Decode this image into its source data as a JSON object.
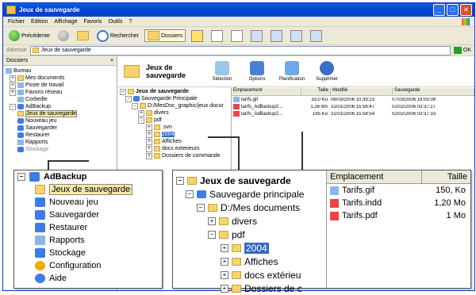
{
  "window": {
    "title": "Jeux de sauvegarde",
    "controls": [
      "_",
      "□",
      "×"
    ]
  },
  "menu": [
    "Fichier",
    "Edition",
    "Affichage",
    "Favoris",
    "Outils",
    "?"
  ],
  "toolbar": {
    "back": "Précédente",
    "search": "Rechercher",
    "folders": "Dossiers"
  },
  "address": {
    "label": "Adresse",
    "value": "Jeux de sauvegarde",
    "go": "OK"
  },
  "sidebar": {
    "title": "Dossiers",
    "close": "×",
    "items": [
      "Bureau",
      "Mes documents",
      "Poste de travail",
      "Favoris réseau",
      "Corbeille",
      "AdBackup",
      "Jeux de sauvegarde",
      "Nouveau jeu",
      "Sauvegarder",
      "Restaurer",
      "Rapports",
      "Stockage"
    ]
  },
  "app": {
    "title": "Jeux de sauvegarde",
    "tools": [
      "Sélection",
      "Options",
      "Planification",
      "Supprimer"
    ]
  },
  "small_tree": [
    "Jeux de sauvegarde",
    "Sauvegarde Principale",
    "D:/MesDoc_graphic/jeux docur",
    "divers",
    "pdf",
    ".svn",
    "2004",
    "Affiches",
    "docs exterieurs",
    "Dossiers de commande"
  ],
  "small_list": {
    "headers": [
      "Emplacement",
      "Taille",
      "Modifié",
      "Sauvegarde"
    ],
    "rows": [
      [
        "tarifs.gif",
        "33,0 Ko",
        "06/03/2006 10:39:23",
        "07/03/2006 19:05:08"
      ],
      [
        "tarifs_AdBackup2...",
        "1,26 Mo",
        "31/01/2006 15:58:47",
        "02/02/2006 03:37:27"
      ],
      [
        "tarifs_AdBackup2...",
        "195 Ko",
        "31/01/2006 15:58:54",
        "02/02/2006 03:37:33"
      ]
    ]
  },
  "zoom_left": {
    "root": "AdBackup",
    "items": [
      "Jeux de sauvegarde",
      "Nouveau jeu",
      "Sauvegarder",
      "Restaurer",
      "Rapports",
      "Stockage",
      "Configuration",
      "Aide"
    ]
  },
  "zoom_right": {
    "tree": [
      "Jeux de sauvegarde",
      "Sauvegarde principale",
      "D:/Mes documents",
      "divers",
      "pdf",
      "2004",
      "Affiches",
      "docs extérieu",
      "Dossiers de c"
    ],
    "headers": [
      "Emplacement",
      "Taille"
    ],
    "rows": [
      [
        "Tarifs.gif",
        "150, Ko"
      ],
      [
        "Tarifs.indd",
        "1,20 Mo"
      ],
      [
        "Tarifs.pdf",
        "1 Mo"
      ]
    ]
  }
}
